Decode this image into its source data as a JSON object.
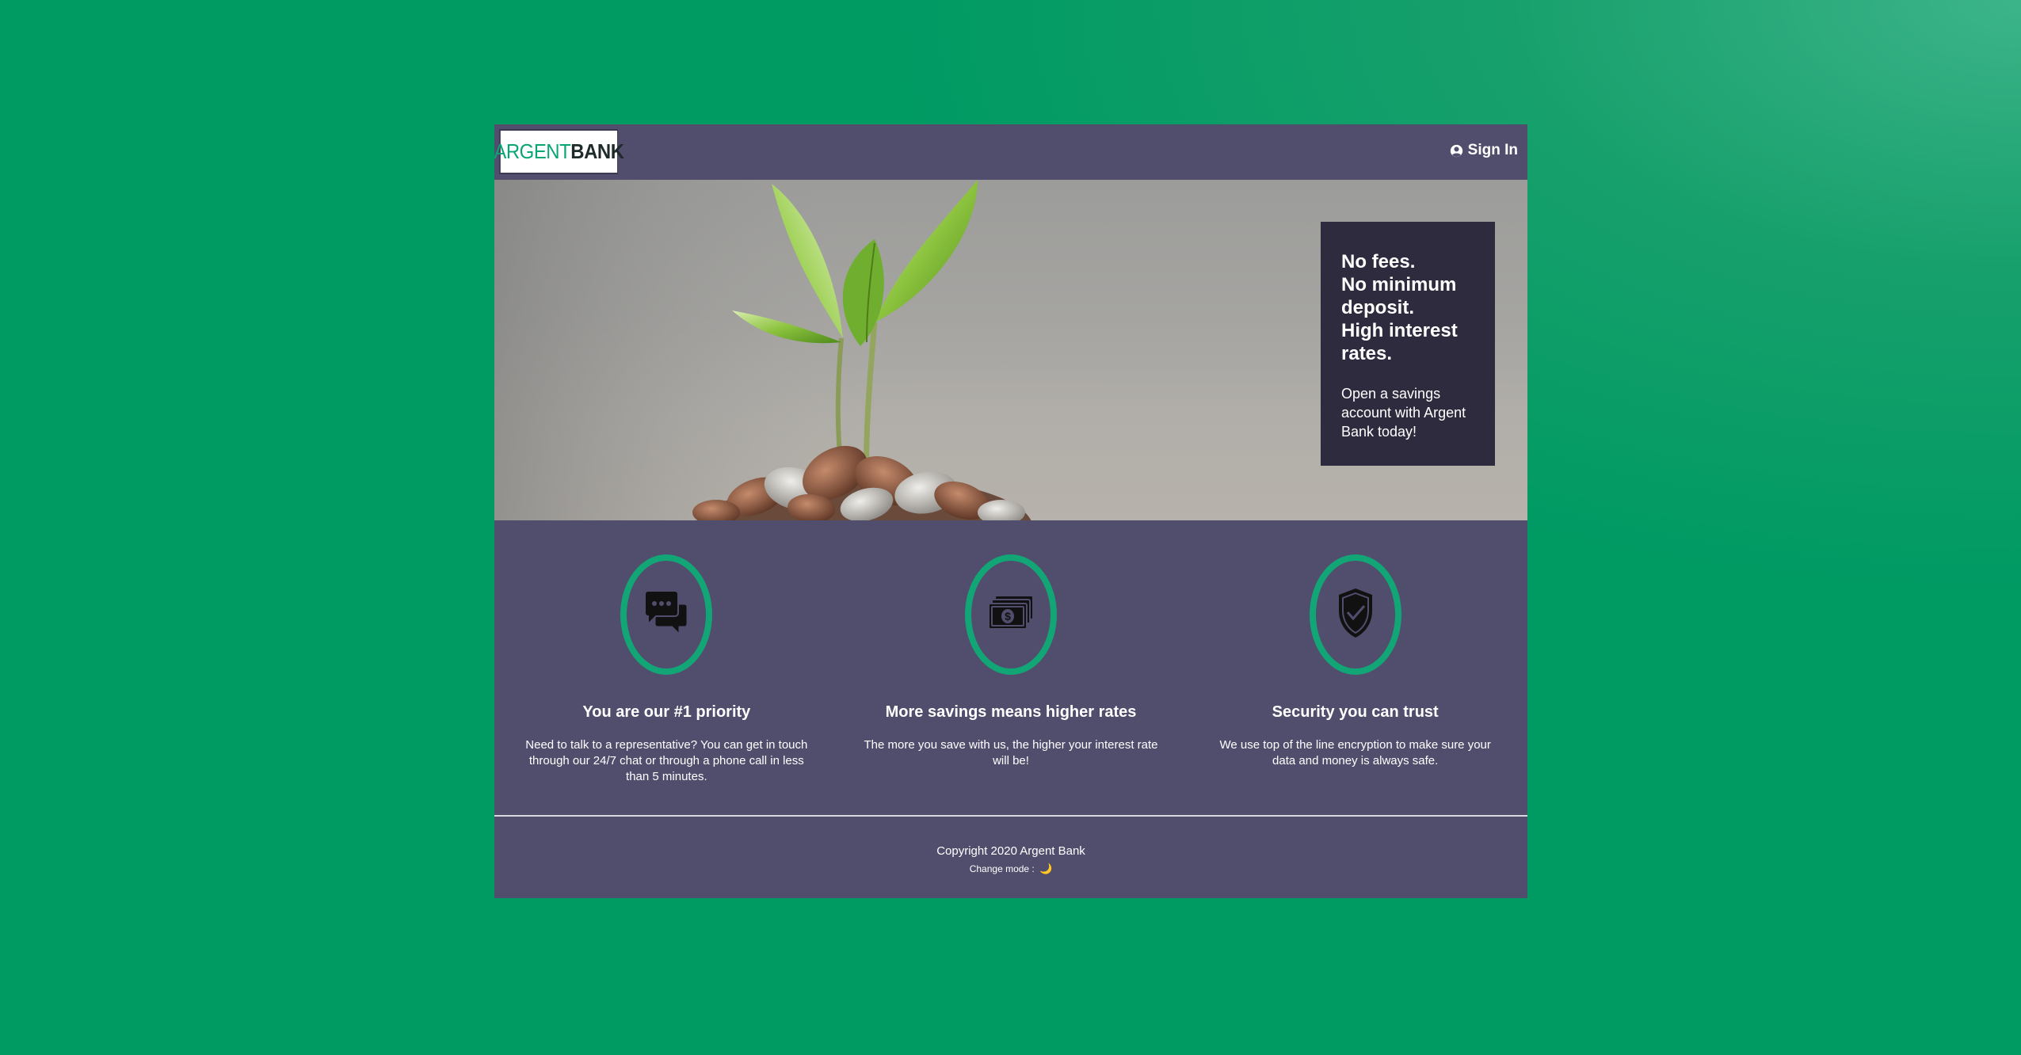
{
  "header": {
    "logo_part1": "ARGENT",
    "logo_part2": "BANK",
    "signin_label": "Sign In",
    "signin_icon": "user-circle-icon"
  },
  "hero": {
    "headline": [
      "No fees.",
      "No minimum",
      "deposit.",
      "High interest",
      "rates."
    ],
    "subtitle": "Open a savings account with Argent Bank today!"
  },
  "features": [
    {
      "icon": "chat-icon",
      "title": "You are our #1 priority",
      "description": "Need to talk to a representative? You can get in touch through our 24/7 chat or through a phone call in less than 5 minutes."
    },
    {
      "icon": "money-icon",
      "title": "More savings means higher rates",
      "description": "The more you save with us, the higher your interest rate will be!"
    },
    {
      "icon": "security-shield-icon",
      "title": "Security you can trust",
      "description": "We use top of the line encryption to make sure your data and money is always safe."
    }
  ],
  "footer": {
    "copyright": "Copyright 2020 Argent Bank",
    "mode_label": "Change mode :",
    "mode_icon": "🌙"
  },
  "colors": {
    "background": "#009a63",
    "panel": "#514d6d",
    "card": "#2d2b3d",
    "accent": "#12a676"
  }
}
